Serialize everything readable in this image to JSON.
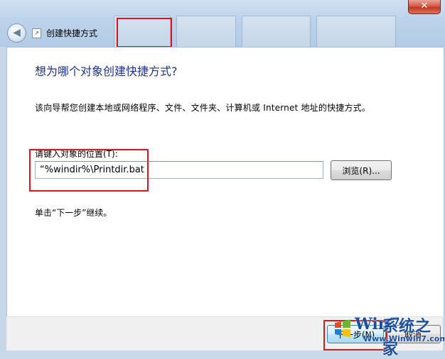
{
  "window": {
    "title": "创建快捷方式",
    "close_glyph": "✕",
    "back_glyph": "◀"
  },
  "content": {
    "heading": "想为哪个对象创建快捷方式?",
    "description": "该向导帮您创建本地或网络程序、文件、文件夹、计算机或 Internet 地址的快捷方式。",
    "location_label": "请键入对象的位置(T):",
    "location_value": "“%windir%\\Printdir.bat",
    "browse_label": "浏览(R)...",
    "hint": "单击“下一步”继续。"
  },
  "footer": {
    "next_label": "下一步(N)",
    "cancel_label": "取消"
  },
  "watermark": {
    "brand_text": "Win7",
    "brand_cn": "系统之家",
    "url": "Www.Winwin7.com"
  },
  "colors": {
    "heading": "#1e3287",
    "highlight_box": "#d8161c",
    "watermark": "#1b4f9c"
  }
}
